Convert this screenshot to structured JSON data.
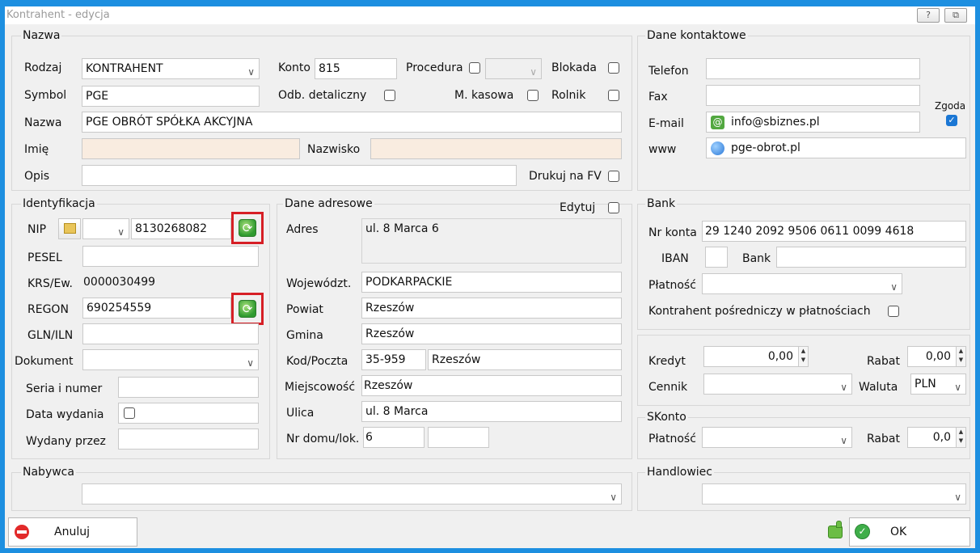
{
  "window": {
    "title": "Kontrahent - edycja",
    "help_label": "?",
    "restore_label": "⧉"
  },
  "nazwa_group": {
    "title": "Nazwa",
    "rodzaj_label": "Rodzaj",
    "rodzaj_value": "KONTRAHENT",
    "konto_label": "Konto",
    "konto_value": "815",
    "procedura_label": "Procedura",
    "blokada_label": "Blokada",
    "symbol_label": "Symbol",
    "symbol_value": "PGE",
    "odb_label": "Odb. detaliczny",
    "mkasowa_label": "M. kasowa",
    "rolnik_label": "Rolnik",
    "nazwa_label": "Nazwa",
    "nazwa_value": "PGE OBRÓT SPÓŁKA AKCYJNA",
    "imie_label": "Imię",
    "imie_value": "",
    "nazwisko_label": "Nazwisko",
    "nazwisko_value": "",
    "opis_label": "Opis",
    "opis_value": "",
    "drukuj_label": "Drukuj na FV"
  },
  "kontakt_group": {
    "title": "Dane kontaktowe",
    "telefon_label": "Telefon",
    "telefon_value": "",
    "fax_label": "Fax",
    "fax_value": "",
    "email_label": "E-mail",
    "email_value": "info@sbiznes.pl",
    "www_label": "www",
    "www_value": "pge-obrot.pl",
    "zgoda_label": "Zgoda"
  },
  "ident_group": {
    "title": "Identyfikacja",
    "nip_label": "NIP",
    "nip_value": "8130268082",
    "pesel_label": "PESEL",
    "pesel_value": "",
    "krs_label": "KRS/Ew.",
    "krs_value": "0000030499",
    "regon_label": "REGON",
    "regon_value": "690254559",
    "gln_label": "GLN/ILN",
    "gln_value": "",
    "dokument_label": "Dokument",
    "dokument_value": "",
    "seria_label": "Seria i numer",
    "seria_value": "",
    "data_label": "Data wydania",
    "wydany_label": "Wydany przez",
    "wydany_value": ""
  },
  "adres_group": {
    "title": "Dane adresowe",
    "edytuj_label": "Edytuj",
    "adres_label": "Adres",
    "adres_value": "ul. 8 Marca 6",
    "woj_label": "Województ.",
    "woj_value": "PODKARPACKIE",
    "powiat_label": "Powiat",
    "powiat_value": "Rzeszów",
    "gmina_label": "Gmina",
    "gmina_value": "Rzeszów",
    "kod_label": "Kod/Poczta",
    "kod_value": "35-959",
    "poczta_value": "Rzeszów",
    "miejsc_label": "Miejscowość",
    "miejsc_value": "Rzeszów",
    "ulica_label": "Ulica",
    "ulica_value": "ul. 8 Marca",
    "nrdomu_label": "Nr domu/lok.",
    "nrdomu_value": "6",
    "nrlok_value": ""
  },
  "bank_group": {
    "title": "Bank",
    "nrkonta_label": "Nr konta",
    "nrkonta_value": "29 1240 2092 9506 0611 0099 4618",
    "iban_label": "IBAN",
    "iban_value": "",
    "bank_label": "Bank",
    "bank_value": "",
    "platnosc_label": "Płatność",
    "platnosc_value": "",
    "posredni_label": "Kontrahent pośredniczy w płatnościach"
  },
  "kredyt_group": {
    "kredyt_label": "Kredyt",
    "kredyt_value": "0,00",
    "rabat_label": "Rabat",
    "rabat_value": "0,00",
    "cennik_label": "Cennik",
    "cennik_value": "",
    "waluta_label": "Waluta",
    "waluta_value": "PLN"
  },
  "skonto_group": {
    "title": "SKonto",
    "platnosc_label": "Płatność",
    "platnosc_value": "",
    "rabat_label": "Rabat",
    "rabat_value": "0,0"
  },
  "nabywca_group": {
    "title": "Nabywca",
    "value": ""
  },
  "handlowiec_group": {
    "title": "Handlowiec",
    "value": ""
  },
  "footer": {
    "cancel_label": "Anuluj",
    "ok_label": "OK"
  }
}
